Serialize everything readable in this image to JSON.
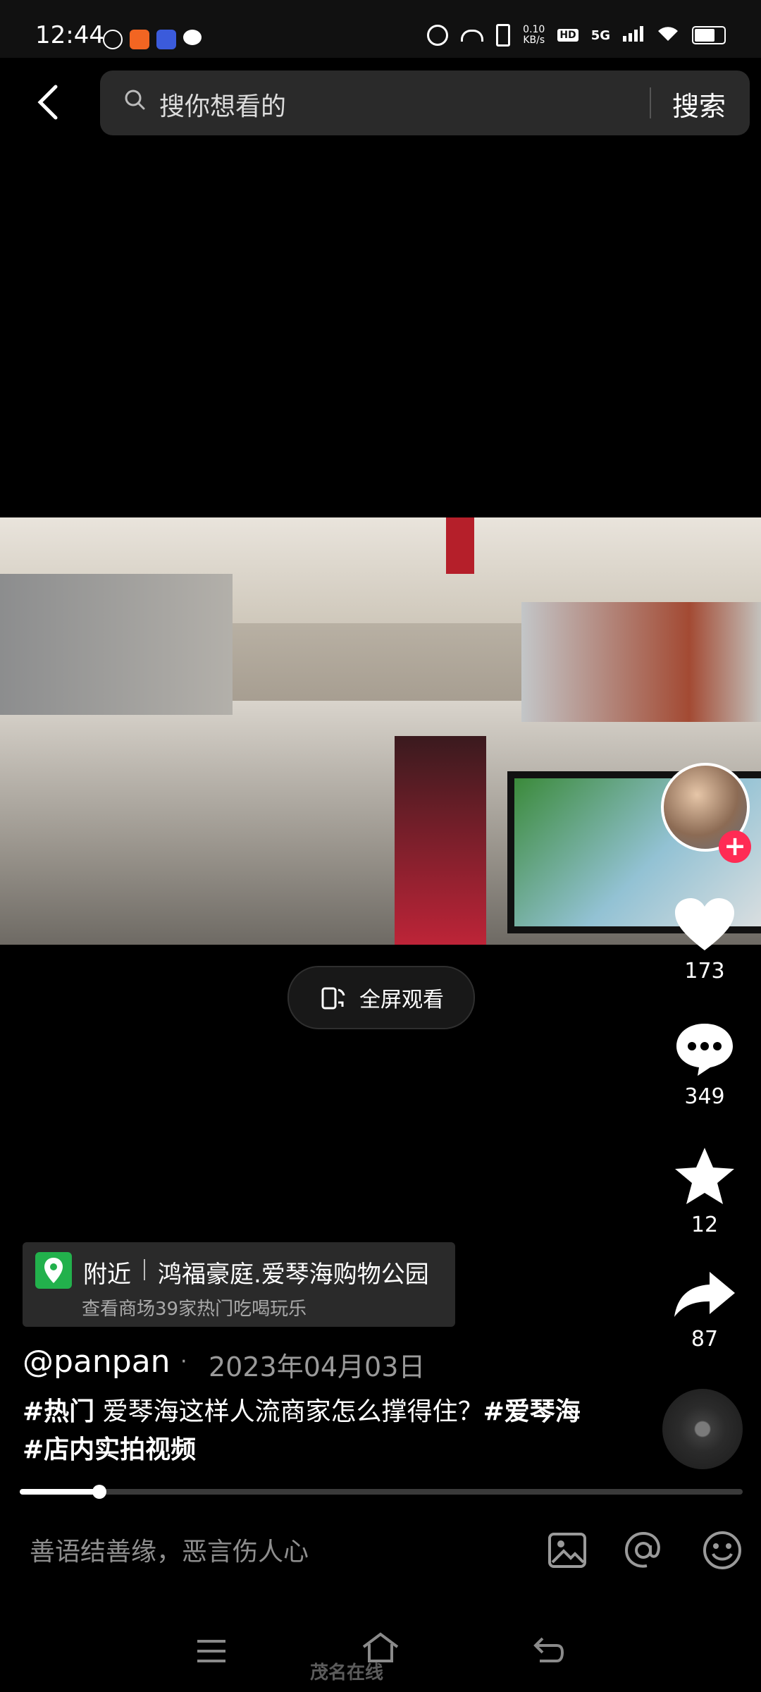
{
  "status_bar": {
    "time": "12:44",
    "net_speed": "0.10\nKB/s",
    "net_speed_value": "0.10",
    "net_speed_unit": "KB/s",
    "hd_label": "HD",
    "network": "5G"
  },
  "search": {
    "placeholder": "搜你想看的",
    "button": "搜索"
  },
  "video": {
    "fullscreen_label": "全屏观看"
  },
  "rail": {
    "likes": "173",
    "comments": "349",
    "favorites": "12",
    "shares": "87"
  },
  "location": {
    "prefix": "附近",
    "name": "鸿福豪庭.爱琴海购物公园",
    "subtitle": "查看商场39家热门吃喝玩乐"
  },
  "post": {
    "username": "@panpan",
    "separator": "·",
    "date": "2023年04月03日",
    "tag1": "#热门",
    "text": " 爱琴海这样人流商家怎么撑得住？",
    "tag2": "#爱琴海",
    "tag3": "#店内实拍视频",
    "progress_fraction": 0.11
  },
  "comment_bar": {
    "placeholder": "善语结善缘，恶言伤人心"
  },
  "watermark": "茂名在线"
}
